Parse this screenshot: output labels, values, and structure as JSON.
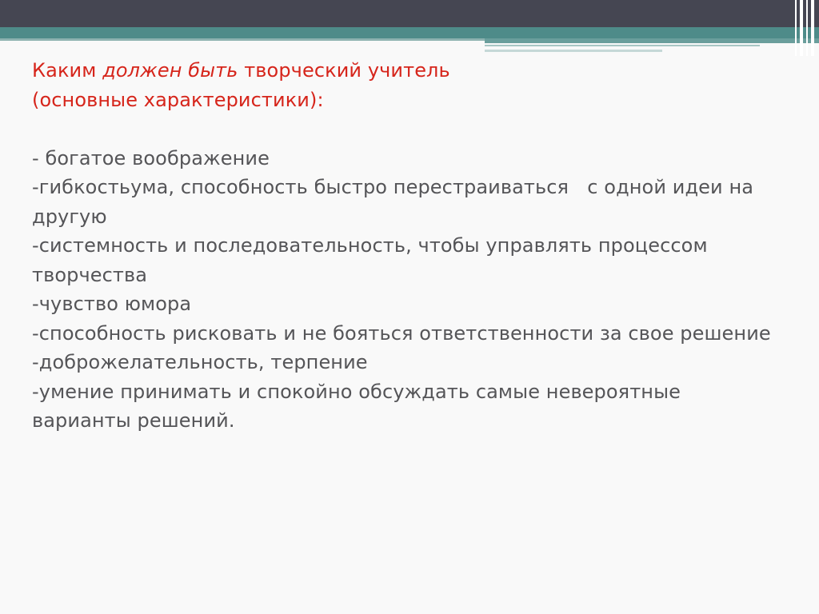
{
  "slide": {
    "title": {
      "part1": "Каким ",
      "part2_italic": "должен быть",
      "part3": " творческий учитель",
      "line2": "(основные характеристики):"
    },
    "items": [
      "- богатое воображение",
      "-гибкостьума, способность быстро перестраиваться   с одной идеи на другую",
      "-системность и последовательность, чтобы управлять процессом творчества",
      "-чувство юмора",
      "-способность рисковать и не бояться ответственности за свое решение",
      "-доброжелательность, терпение",
      "-умение принимать и спокойно обсуждать самые невероятные варианты решений."
    ]
  },
  "colors": {
    "title": "#d6251b",
    "body_text": "#555558",
    "header_dark": "#454652",
    "header_teal": "#4e8b89"
  }
}
